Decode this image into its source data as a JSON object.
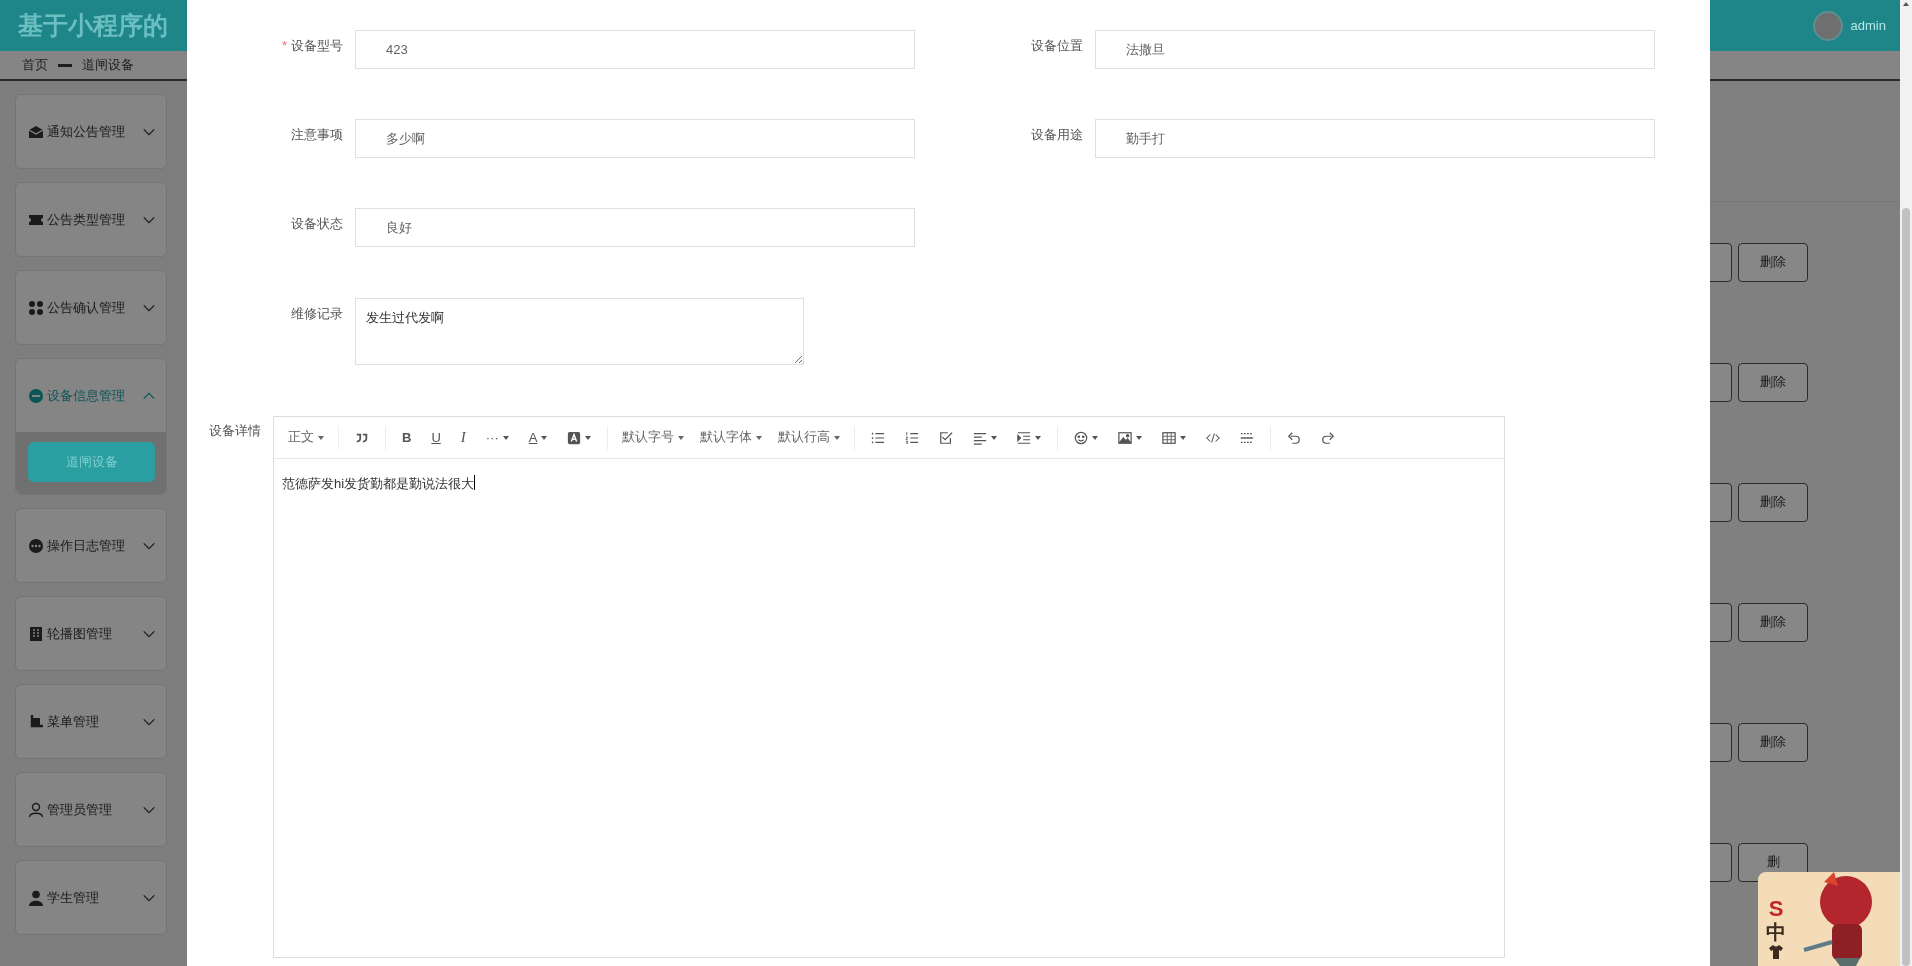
{
  "header": {
    "title": "基于小程序的",
    "user": "admin"
  },
  "breadcrumb": [
    "首页",
    "道闸设备"
  ],
  "sidebar": {
    "menus": [
      {
        "label": "通知公告管理",
        "expanded": false
      },
      {
        "label": "公告类型管理",
        "expanded": false
      },
      {
        "label": "公告确认管理",
        "expanded": false
      },
      {
        "label": "设备信息管理",
        "expanded": true,
        "children": [
          {
            "label": "道闸设备",
            "selected": true
          }
        ]
      },
      {
        "label": "操作日志管理",
        "expanded": false
      },
      {
        "label": "轮播图管理",
        "expanded": false
      },
      {
        "label": "菜单管理",
        "expanded": false
      },
      {
        "label": "管理员管理",
        "expanded": false
      },
      {
        "label": "学生管理",
        "expanded": false
      }
    ]
  },
  "table_rows": [
    {
      "delete_button": "删除"
    },
    {
      "delete_button": "删除"
    },
    {
      "delete_button": "删除"
    },
    {
      "delete_button": "删除"
    },
    {
      "delete_button": "删除"
    },
    {
      "delete_button": "删"
    }
  ],
  "dialog": {
    "fields": [
      {
        "label": "设备型号",
        "value": "423",
        "required_mark": "*"
      },
      {
        "label": "设备位置",
        "value": "法撒旦"
      },
      {
        "label": "注意事项",
        "value": "多少啊"
      },
      {
        "label": "设备用途",
        "value": "勤手打"
      },
      {
        "label": "设备状态",
        "value": "良好"
      }
    ],
    "repair_record": {
      "label": "维修记录",
      "value": "发生过代发啊"
    },
    "editor": {
      "label": "设备详情",
      "content": "范德萨发hi发货勤都是勤说法很大",
      "toolbar": [
        {
          "items": [
            {
              "kind": "dropdown",
              "label": "正文"
            }
          ]
        },
        {
          "items": [
            {
              "kind": "icon",
              "caret": false
            }
          ]
        },
        {
          "items": [
            {
              "kind": "glyph",
              "label": "B",
              "bold": true,
              "underline": false,
              "italic": false,
              "caret": false
            },
            {
              "kind": "glyph",
              "label": "U",
              "bold": false,
              "underline": true,
              "italic": false,
              "caret": false
            },
            {
              "kind": "glyph",
              "label": "I",
              "bold": false,
              "underline": false,
              "italic": true,
              "caret": false
            },
            {
              "kind": "glyph",
              "label": "···",
              "bold": false,
              "underline": false,
              "italic": false,
              "caret": true
            },
            {
              "kind": "glyph",
              "label": "A",
              "bold": false,
              "underline": true,
              "italic": false,
              "caret": true
            },
            {
              "kind": "icon",
              "caret": true
            }
          ]
        },
        {
          "items": [
            {
              "kind": "dropdown",
              "label": "默认字号"
            },
            {
              "kind": "dropdown",
              "label": "默认字体"
            },
            {
              "kind": "dropdown",
              "label": "默认行高"
            }
          ]
        },
        {
          "items": [
            {
              "kind": "icon",
              "caret": false
            },
            {
              "kind": "icon",
              "caret": false
            },
            {
              "kind": "icon",
              "caret": false
            },
            {
              "kind": "icon",
              "caret": true
            },
            {
              "kind": "icon",
              "caret": true
            }
          ]
        },
        {
          "items": [
            {
              "kind": "icon",
              "caret": true
            },
            {
              "kind": "icon",
              "caret": true
            },
            {
              "kind": "icon",
              "caret": true
            },
            {
              "kind": "icon",
              "caret": false
            },
            {
              "kind": "icon",
              "caret": false
            }
          ]
        },
        {
          "items": [
            {
              "kind": "icon",
              "caret": false
            },
            {
              "kind": "icon",
              "caret": false
            }
          ]
        }
      ]
    }
  },
  "ime_toolbar": {
    "texts": [
      "S",
      "中"
    ]
  }
}
